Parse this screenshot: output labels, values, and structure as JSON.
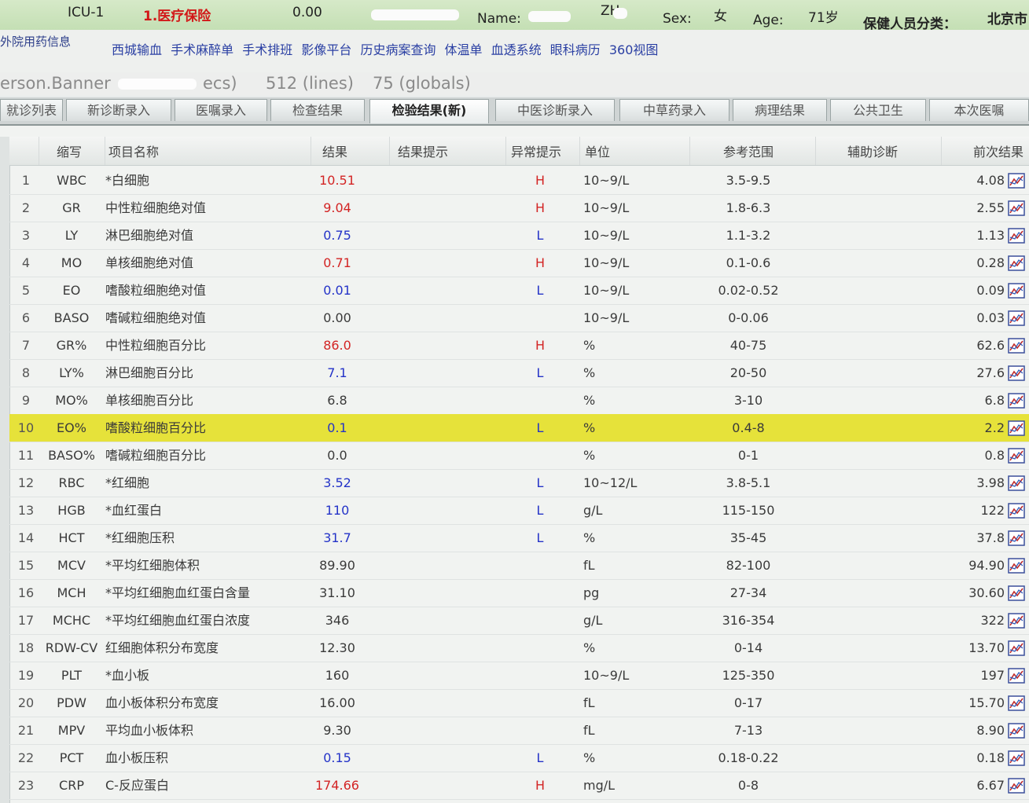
{
  "header": {
    "ward": "ICU-1",
    "insurance": "1.医疗保险",
    "amount": "0.00",
    "name_label": "Name:",
    "name_value_partial": "ZH",
    "sex_label": "Sex:",
    "sex_value": "女",
    "age_label": "Age:",
    "age_value": "71岁",
    "staff_class_label": "保健人员分类：",
    "city": "北京市"
  },
  "links": {
    "outside_meds": "外院用药信息",
    "items": [
      "西城输血",
      "手术麻醉单",
      "手术排班",
      "影像平台",
      "历史病案查询",
      "体温单",
      "血透系统",
      "眼科病历",
      "360视图"
    ]
  },
  "console": {
    "prefix": "erson.Banner",
    "secs": "ecs)",
    "lines": "512 (lines)",
    "globals": "75 (globals)"
  },
  "tabs": [
    "就诊列表",
    "新诊断录入",
    "医嘱录入",
    "检查结果",
    "检验结果(新)",
    "中医诊断录入",
    "中草药录入",
    "病理结果",
    "公共卫生",
    "本次医嘱"
  ],
  "active_tab": "检验结果(新)",
  "columns": {
    "abbr": "缩写",
    "name": "项目名称",
    "result": "结果",
    "result_hint": "结果提示",
    "abnormal": "异常提示",
    "unit": "单位",
    "reference": "参考范围",
    "aux": "辅助诊断",
    "previous": "前次结果"
  },
  "rows": [
    {
      "no": "1",
      "abbr": "WBC",
      "name": "*白细胞",
      "result": "10.51",
      "flag": "H",
      "unit": "10~9/L",
      "ref": "3.5-9.5",
      "prev": "4.08"
    },
    {
      "no": "2",
      "abbr": "GR",
      "name": "中性粒细胞绝对值",
      "result": "9.04",
      "flag": "H",
      "unit": "10~9/L",
      "ref": "1.8-6.3",
      "prev": "2.55"
    },
    {
      "no": "3",
      "abbr": "LY",
      "name": "淋巴细胞绝对值",
      "result": "0.75",
      "flag": "L",
      "unit": "10~9/L",
      "ref": "1.1-3.2",
      "prev": "1.13"
    },
    {
      "no": "4",
      "abbr": "MO",
      "name": "单核细胞绝对值",
      "result": "0.71",
      "flag": "H",
      "unit": "10~9/L",
      "ref": "0.1-0.6",
      "prev": "0.28"
    },
    {
      "no": "5",
      "abbr": "EO",
      "name": "嗜酸粒细胞绝对值",
      "result": "0.01",
      "flag": "L",
      "unit": "10~9/L",
      "ref": "0.02-0.52",
      "prev": "0.09"
    },
    {
      "no": "6",
      "abbr": "BASO",
      "name": "嗜碱粒细胞绝对值",
      "result": "0.00",
      "flag": "",
      "unit": "10~9/L",
      "ref": "0-0.06",
      "prev": "0.03"
    },
    {
      "no": "7",
      "abbr": "GR%",
      "name": "中性粒细胞百分比",
      "result": "86.0",
      "flag": "H",
      "unit": "%",
      "ref": "40-75",
      "prev": "62.6"
    },
    {
      "no": "8",
      "abbr": "LY%",
      "name": "淋巴细胞百分比",
      "result": "7.1",
      "flag": "L",
      "unit": "%",
      "ref": "20-50",
      "prev": "27.6"
    },
    {
      "no": "9",
      "abbr": "MO%",
      "name": "单核细胞百分比",
      "result": "6.8",
      "flag": "",
      "unit": "%",
      "ref": "3-10",
      "prev": "6.8"
    },
    {
      "no": "10",
      "abbr": "EO%",
      "name": "嗜酸粒细胞百分比",
      "result": "0.1",
      "flag": "L",
      "unit": "%",
      "ref": "0.4-8",
      "prev": "2.2",
      "selected": true
    },
    {
      "no": "11",
      "abbr": "BASO%",
      "name": "嗜碱粒细胞百分比",
      "result": "0.0",
      "flag": "",
      "unit": "%",
      "ref": "0-1",
      "prev": "0.8"
    },
    {
      "no": "12",
      "abbr": "RBC",
      "name": "*红细胞",
      "result": "3.52",
      "flag": "L",
      "unit": "10~12/L",
      "ref": "3.8-5.1",
      "prev": "3.98"
    },
    {
      "no": "13",
      "abbr": "HGB",
      "name": "*血红蛋白",
      "result": "110",
      "flag": "L",
      "unit": "g/L",
      "ref": "115-150",
      "prev": "122"
    },
    {
      "no": "14",
      "abbr": "HCT",
      "name": "*红细胞压积",
      "result": "31.7",
      "flag": "L",
      "unit": "%",
      "ref": "35-45",
      "prev": "37.8"
    },
    {
      "no": "15",
      "abbr": "MCV",
      "name": "*平均红细胞体积",
      "result": "89.90",
      "flag": "",
      "unit": "fL",
      "ref": "82-100",
      "prev": "94.90"
    },
    {
      "no": "16",
      "abbr": "MCH",
      "name": "*平均红细胞血红蛋白含量",
      "result": "31.10",
      "flag": "",
      "unit": "pg",
      "ref": "27-34",
      "prev": "30.60"
    },
    {
      "no": "17",
      "abbr": "MCHC",
      "name": "*平均红细胞血红蛋白浓度",
      "result": "346",
      "flag": "",
      "unit": "g/L",
      "ref": "316-354",
      "prev": "322"
    },
    {
      "no": "18",
      "abbr": "RDW-CV",
      "name": "红细胞体积分布宽度",
      "result": "12.30",
      "flag": "",
      "unit": "%",
      "ref": "0-14",
      "prev": "13.70"
    },
    {
      "no": "19",
      "abbr": "PLT",
      "name": "*血小板",
      "result": "160",
      "flag": "",
      "unit": "10~9/L",
      "ref": "125-350",
      "prev": "197"
    },
    {
      "no": "20",
      "abbr": "PDW",
      "name": "血小板体积分布宽度",
      "result": "16.00",
      "flag": "",
      "unit": "fL",
      "ref": "0-17",
      "prev": "15.70"
    },
    {
      "no": "21",
      "abbr": "MPV",
      "name": "平均血小板体积",
      "result": "9.30",
      "flag": "",
      "unit": "fL",
      "ref": "7-13",
      "prev": "8.90"
    },
    {
      "no": "22",
      "abbr": "PCT",
      "name": "血小板压积",
      "result": "0.15",
      "flag": "L",
      "unit": "%",
      "ref": "0.18-0.22",
      "prev": "0.18"
    },
    {
      "no": "23",
      "abbr": "CRP",
      "name": "C-反应蛋白",
      "result": "174.66",
      "flag": "H",
      "unit": "mg/L",
      "ref": "0-8",
      "prev": "6.67"
    }
  ],
  "colors": {
    "high": "#d32424",
    "low": "#2433c8",
    "selected_row": "#e6e23a",
    "header_bar": "#c4dfb4"
  }
}
